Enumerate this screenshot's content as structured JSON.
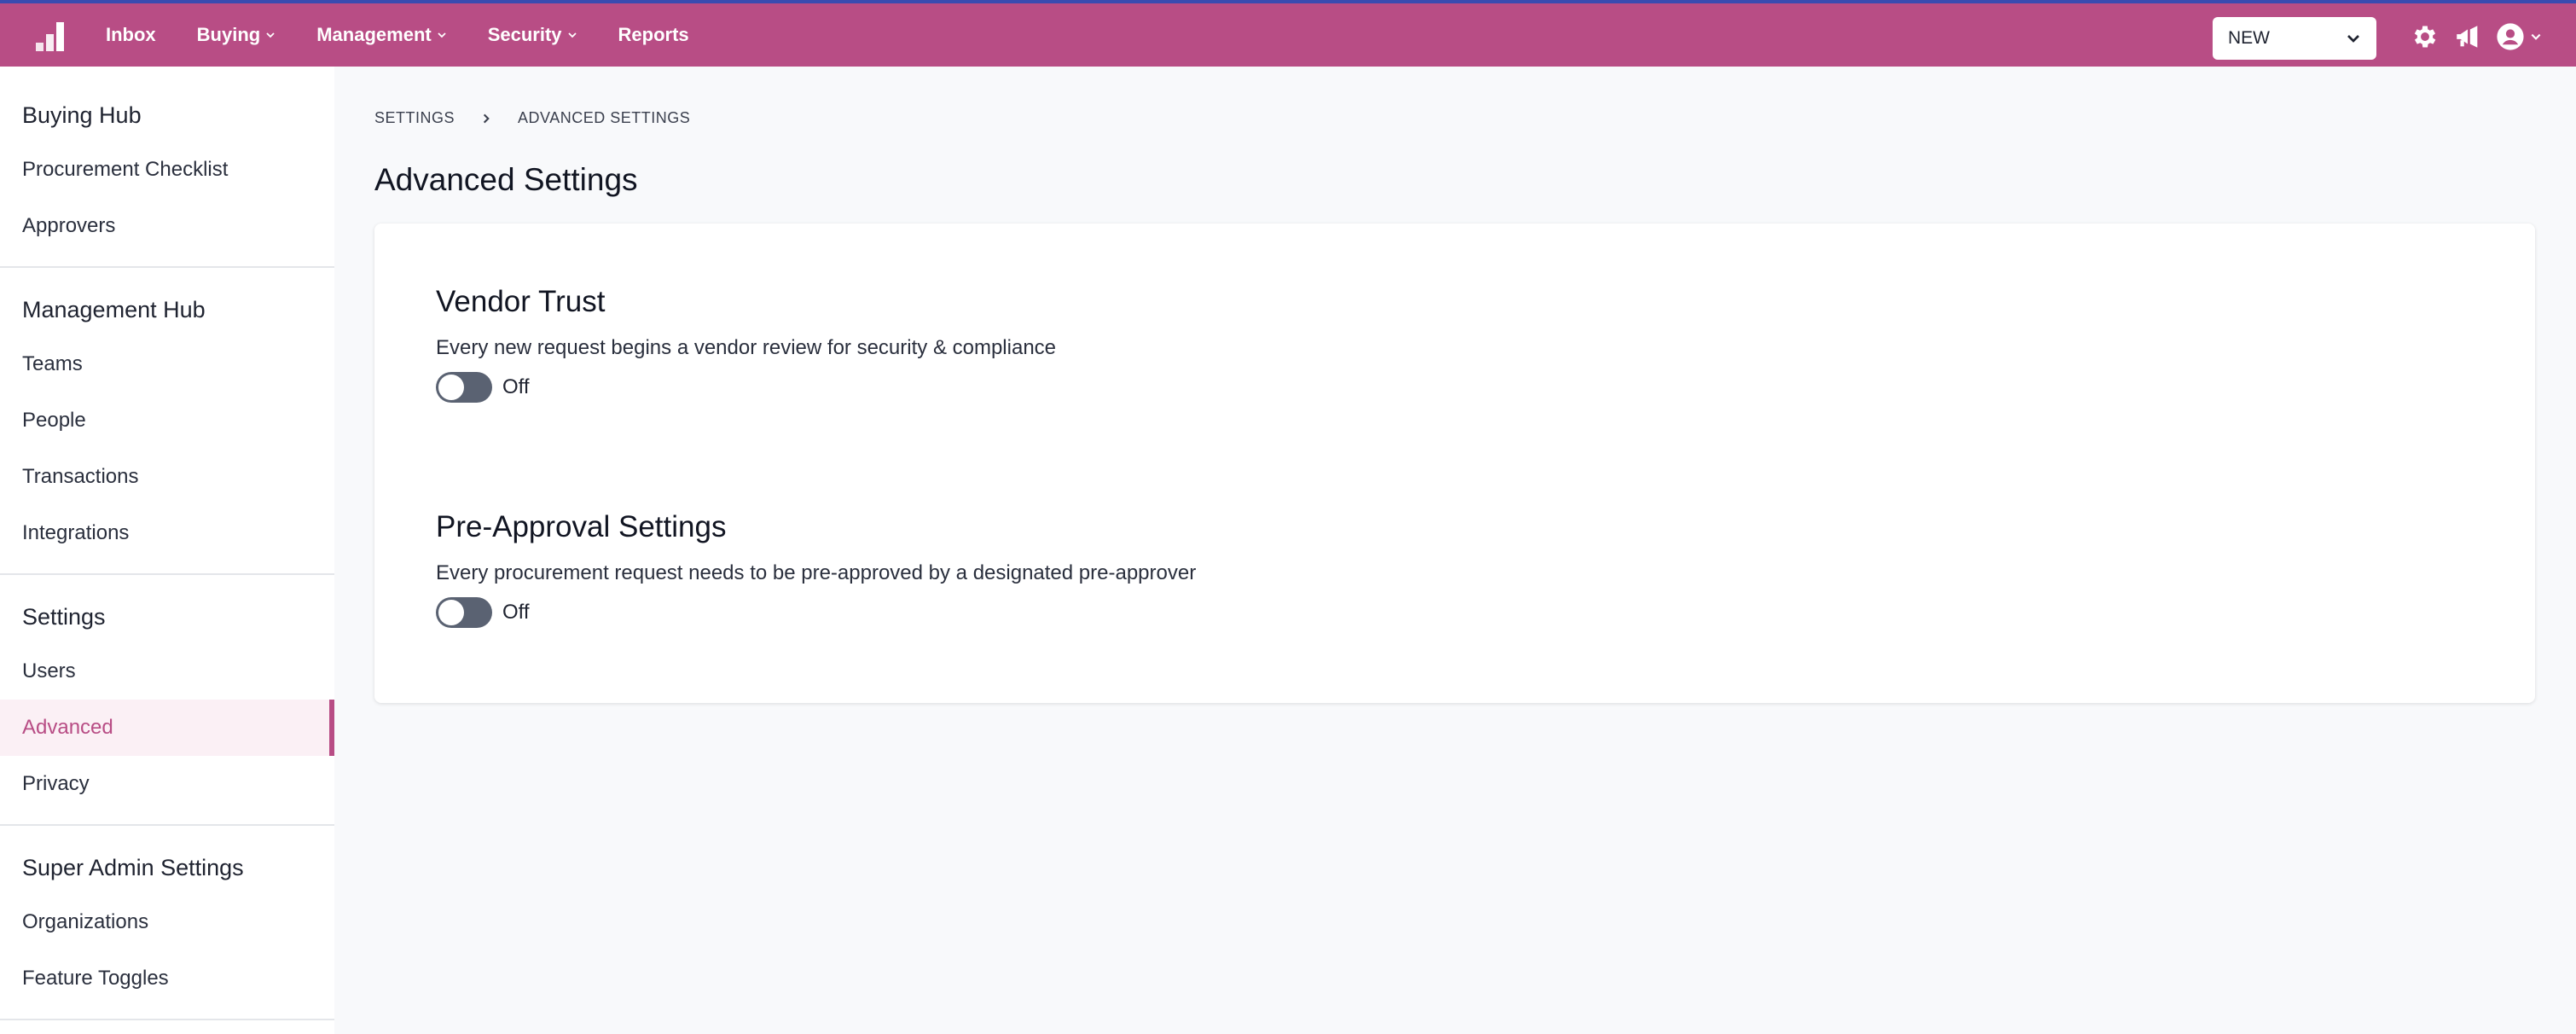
{
  "colors": {
    "brand": "#b84d85",
    "topbar_border": "#3a4bb0",
    "toggle_off": "#5a6272",
    "active_bg": "#fbf0f5"
  },
  "nav": {
    "logo_icon": "bar-chart-logo-icon",
    "items": [
      {
        "label": "Inbox",
        "dropdown": false
      },
      {
        "label": "Buying",
        "dropdown": true
      },
      {
        "label": "Management",
        "dropdown": true
      },
      {
        "label": "Security",
        "dropdown": true
      },
      {
        "label": "Reports",
        "dropdown": false
      }
    ],
    "new_select": {
      "value": "NEW"
    },
    "icons": [
      "gear-icon",
      "megaphone-icon",
      "user-account-icon"
    ]
  },
  "sidebar": {
    "sections": [
      {
        "heading": "Buying Hub",
        "items": [
          "Procurement Checklist",
          "Approvers"
        ]
      },
      {
        "heading": "Management Hub",
        "items": [
          "Teams",
          "People",
          "Transactions",
          "Integrations"
        ]
      },
      {
        "heading": "Settings",
        "items": [
          "Users",
          "Advanced",
          "Privacy"
        ]
      },
      {
        "heading": "Super Admin Settings",
        "items": [
          "Organizations",
          "Feature Toggles"
        ]
      }
    ],
    "active_item": "Advanced"
  },
  "breadcrumb": {
    "items": [
      "SETTINGS",
      "ADVANCED SETTINGS"
    ]
  },
  "page": {
    "title": "Advanced Settings"
  },
  "settings": [
    {
      "title": "Vendor Trust",
      "description": "Every new request begins a vendor review for security & compliance",
      "state": "Off"
    },
    {
      "title": "Pre-Approval Settings",
      "description": "Every procurement request needs to be pre-approved by a designated pre-approver",
      "state": "Off"
    }
  ]
}
